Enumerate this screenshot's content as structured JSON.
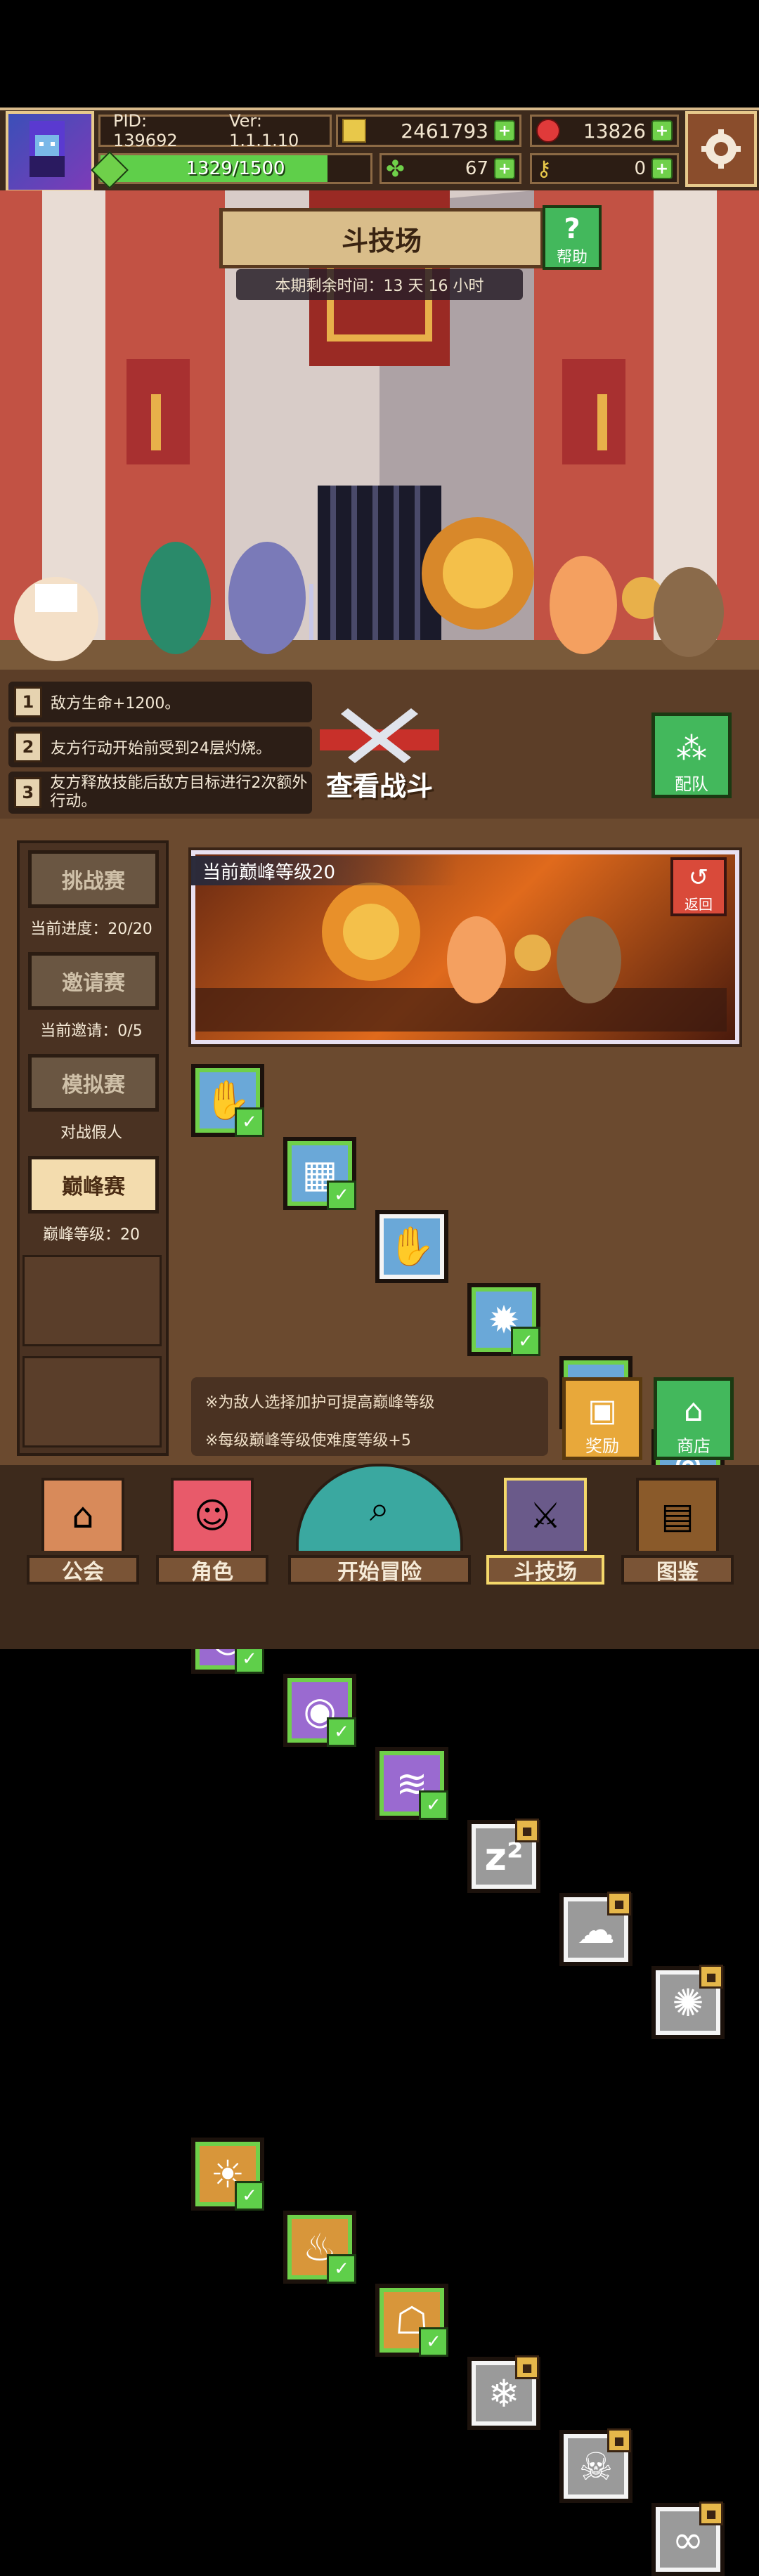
{
  "header": {
    "pid": "PID: 139692",
    "version": "Ver: 1.1.1.10",
    "gold": "2461793",
    "gems": "13826",
    "energy": "1329/1500",
    "clover": "67",
    "key": "0"
  },
  "icons": {
    "avatar": "player-avatar",
    "gold": "gold-coin-icon",
    "gem": "red-gem-icon",
    "energy": "energy-icon",
    "clover": "clover-icon",
    "key": "key-icon",
    "settings": "gear-icon"
  },
  "arena": {
    "title": "斗技场",
    "help_label": "帮助",
    "timer": "本期剩余时间：13 天 16 小时"
  },
  "modifiers": [
    {
      "num": "1",
      "text": "敌方生命+1200。"
    },
    {
      "num": "2",
      "text": "友方行动开始前受到24层灼烧。"
    },
    {
      "num": "3",
      "text": "友方释放技能后敌方目标进行2次额外行动。"
    }
  ],
  "actions": {
    "view_battle": "查看战斗",
    "formation": "配队"
  },
  "modes": [
    {
      "label": "挑战赛",
      "sub": "当前进度：20/20",
      "active": false
    },
    {
      "label": "邀请赛",
      "sub": "当前邀请：0/5",
      "active": false
    },
    {
      "label": "模拟赛",
      "sub": "对战假人",
      "active": false
    },
    {
      "label": "巅峰赛",
      "sub": "巅峰等级：20",
      "active": true
    }
  ],
  "preview": {
    "title": "当前巅峰等级20",
    "return_label": "返回"
  },
  "skills": [
    [
      "claw",
      "wall",
      "paw",
      "sun",
      "shield",
      "gate"
    ],
    [
      "ring",
      "vortex",
      "wave",
      "sleep-locked",
      "cloud-locked",
      "burst-locked"
    ],
    [
      "light",
      "fire",
      "ghost",
      "snow-locked",
      "skull-locked",
      "infinity-locked"
    ]
  ],
  "tips": {
    "line1": "※为敌人选择加护可提高巅峰等级",
    "line2": "※每级巅峰等级使难度等级+5"
  },
  "side_buttons": {
    "reward": "奖励",
    "shop": "商店"
  },
  "nav": [
    {
      "label": "公会",
      "icon": "guild-icon"
    },
    {
      "label": "角色",
      "icon": "character-icon"
    },
    {
      "label": "开始冒险",
      "icon": "adventure-map-icon"
    },
    {
      "label": "斗技场",
      "icon": "crossed-swords-icon",
      "active": true
    },
    {
      "label": "图鉴",
      "icon": "book-icon"
    }
  ],
  "colors": {
    "accent_green": "#43b85c",
    "frame_brown": "#6b4a2f",
    "banner_tan": "#d9bd8a"
  }
}
